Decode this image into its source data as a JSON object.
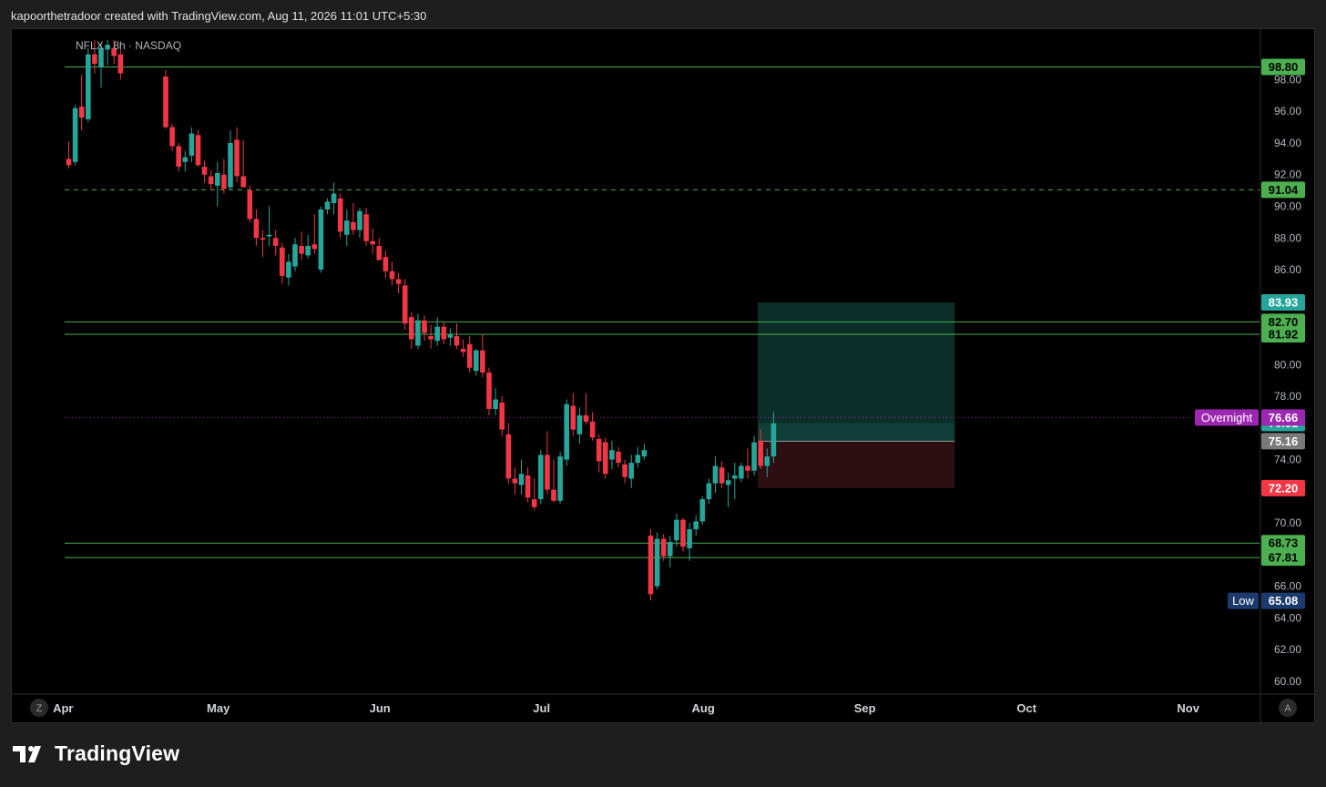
{
  "header": {
    "credit": "kapoorthetradoor created with TradingView.com, Aug 11, 2026 11:01 UTC+5:30"
  },
  "symbol_legend": "NFLX · 8h · NASDAQ",
  "footer": {
    "brand": "TradingView"
  },
  "corner_buttons": {
    "left": "Z",
    "right": "A"
  },
  "colors": {
    "up": "#26a69a",
    "down": "#f23645",
    "level": "#4caf50",
    "target_zone": "#0b2e28",
    "stop_zone": "#2d0e12",
    "overnight": "#9c27b0",
    "low_badge": "#1c3a6e",
    "current": "#7a7a7a"
  },
  "chart_data": {
    "type": "candlestick",
    "ylim": [
      58.5,
      100.5
    ],
    "y_ticks": [
      "60.00",
      "62.00",
      "64.00",
      "66.00",
      "70.00",
      "74.00",
      "78.00",
      "80.00",
      "86.00",
      "88.00",
      "90.00",
      "92.00",
      "94.00",
      "96.00",
      "98.00"
    ],
    "x_ticks": [
      {
        "label": "Apr",
        "bar": -2
      },
      {
        "label": "May",
        "bar": 22
      },
      {
        "label": "Jun",
        "bar": 47
      },
      {
        "label": "Jul",
        "bar": 72
      },
      {
        "label": "Aug",
        "bar": 97
      },
      {
        "label": "Sep",
        "bar": 122
      },
      {
        "label": "Oct",
        "bar": 147
      },
      {
        "label": "Nov",
        "bar": 172
      }
    ],
    "candles": [
      [
        0,
        93.0,
        94.1,
        92.4,
        92.6
      ],
      [
        1,
        92.8,
        96.4,
        92.6,
        96.2
      ],
      [
        2,
        96.3,
        98.3,
        94.8,
        95.6
      ],
      [
        3,
        95.5,
        100.0,
        95.3,
        99.6
      ],
      [
        4,
        99.6,
        100.5,
        98.4,
        99.0
      ],
      [
        5,
        98.8,
        100.3,
        97.5,
        100.0
      ],
      [
        6,
        99.9,
        100.5,
        98.9,
        100.2
      ],
      [
        7,
        100.0,
        100.5,
        99.0,
        99.5
      ],
      [
        8,
        99.6,
        100.3,
        98.0,
        98.4
      ],
      [
        15,
        98.2,
        98.6,
        94.9,
        95.0
      ],
      [
        16,
        95.0,
        95.2,
        93.5,
        93.8
      ],
      [
        17,
        93.8,
        94.0,
        92.2,
        92.5
      ],
      [
        18,
        92.8,
        93.5,
        92.2,
        93.1
      ],
      [
        19,
        93.2,
        95.0,
        92.8,
        94.6
      ],
      [
        20,
        94.5,
        94.8,
        92.5,
        92.6
      ],
      [
        21,
        92.5,
        92.9,
        91.5,
        92.0
      ],
      [
        22,
        91.9,
        92.3,
        91.0,
        91.4
      ],
      [
        23,
        91.3,
        92.8,
        90.0,
        92.1
      ],
      [
        24,
        92.0,
        93.0,
        90.8,
        91.1
      ],
      [
        25,
        91.2,
        94.8,
        91.0,
        94.0
      ],
      [
        26,
        94.2,
        95.0,
        91.5,
        91.9
      ],
      [
        27,
        91.9,
        94.2,
        91.4,
        91.2
      ],
      [
        28,
        91.0,
        91.3,
        89.0,
        89.2
      ],
      [
        29,
        89.2,
        89.8,
        87.5,
        88.0
      ],
      [
        30,
        88.0,
        88.5,
        86.8,
        87.9
      ],
      [
        31,
        88.1,
        90.0,
        87.5,
        88.2
      ],
      [
        32,
        88.0,
        88.5,
        86.9,
        87.5
      ],
      [
        33,
        87.4,
        87.7,
        85.1,
        85.6
      ],
      [
        34,
        85.5,
        87.0,
        85.0,
        86.5
      ],
      [
        35,
        86.2,
        88.0,
        85.9,
        87.6
      ],
      [
        36,
        87.5,
        88.4,
        86.6,
        87.0
      ],
      [
        37,
        86.9,
        88.2,
        86.7,
        87.5
      ],
      [
        38,
        87.6,
        89.5,
        87.0,
        87.3
      ],
      [
        39,
        86.0,
        90.0,
        85.8,
        89.8
      ],
      [
        40,
        89.8,
        90.5,
        89.5,
        90.3
      ],
      [
        41,
        90.2,
        91.5,
        89.5,
        90.8
      ],
      [
        42,
        90.5,
        90.8,
        88.0,
        88.4
      ],
      [
        43,
        88.2,
        89.8,
        87.5,
        89.1
      ],
      [
        44,
        89.0,
        90.2,
        88.2,
        88.5
      ],
      [
        45,
        88.5,
        89.9,
        88.0,
        89.7
      ],
      [
        46,
        89.5,
        89.9,
        87.5,
        87.8
      ],
      [
        47,
        87.8,
        88.6,
        87.0,
        87.6
      ],
      [
        48,
        87.5,
        88.0,
        86.6,
        86.6
      ],
      [
        49,
        86.8,
        87.2,
        85.5,
        85.9
      ],
      [
        50,
        85.9,
        86.5,
        85.0,
        85.4
      ],
      [
        51,
        85.4,
        85.8,
        84.5,
        85.1
      ],
      [
        52,
        85.0,
        85.4,
        82.2,
        82.6
      ],
      [
        53,
        83.0,
        83.3,
        81.0,
        81.6
      ],
      [
        54,
        81.2,
        83.2,
        81.0,
        82.8
      ],
      [
        55,
        82.8,
        83.1,
        81.5,
        82.0
      ],
      [
        56,
        81.8,
        82.5,
        81.0,
        81.6
      ],
      [
        57,
        81.5,
        83.0,
        81.2,
        82.4
      ],
      [
        58,
        82.4,
        82.7,
        81.3,
        81.6
      ],
      [
        59,
        81.7,
        82.3,
        81.2,
        81.9
      ],
      [
        60,
        81.8,
        82.6,
        81.0,
        81.2
      ],
      [
        61,
        81.0,
        81.6,
        80.5,
        80.8
      ],
      [
        62,
        81.3,
        81.8,
        79.5,
        79.8
      ],
      [
        63,
        79.6,
        81.0,
        79.3,
        80.9
      ],
      [
        64,
        80.9,
        81.9,
        79.2,
        79.5
      ],
      [
        65,
        79.5,
        79.8,
        76.8,
        77.2
      ],
      [
        66,
        77.2,
        78.5,
        76.8,
        77.8
      ],
      [
        67,
        77.6,
        78.0,
        75.5,
        75.9
      ],
      [
        68,
        75.6,
        76.3,
        72.5,
        72.8
      ],
      [
        69,
        72.8,
        73.5,
        71.8,
        72.5
      ],
      [
        70,
        72.4,
        74.0,
        71.8,
        73.1
      ],
      [
        71,
        73.0,
        73.5,
        71.3,
        71.6
      ],
      [
        72,
        71.5,
        72.8,
        70.8,
        71.0
      ],
      [
        73,
        71.5,
        74.6,
        71.2,
        74.3
      ],
      [
        74,
        74.3,
        75.8,
        71.8,
        72.1
      ],
      [
        75,
        72.1,
        74.0,
        71.3,
        71.4
      ],
      [
        76,
        71.4,
        74.5,
        71.2,
        74.2
      ],
      [
        77,
        74.0,
        77.8,
        73.6,
        77.5
      ],
      [
        78,
        77.4,
        78.2,
        75.5,
        75.9
      ],
      [
        79,
        75.6,
        77.3,
        75.0,
        76.8
      ],
      [
        80,
        76.8,
        78.2,
        76.2,
        76.4
      ],
      [
        81,
        76.4,
        77.0,
        75.2,
        75.4
      ],
      [
        82,
        75.3,
        75.6,
        73.2,
        73.9
      ],
      [
        83,
        75.1,
        75.4,
        72.8,
        73.1
      ],
      [
        84,
        74.0,
        75.2,
        73.4,
        74.6
      ],
      [
        85,
        74.5,
        74.8,
        73.5,
        73.8
      ],
      [
        86,
        73.7,
        74.0,
        72.5,
        72.9
      ],
      [
        87,
        72.8,
        74.3,
        72.2,
        73.8
      ],
      [
        88,
        73.8,
        74.8,
        73.5,
        74.3
      ],
      [
        89,
        74.2,
        75.0,
        74.0,
        74.6
      ],
      [
        90,
        69.2,
        69.6,
        65.1,
        65.5
      ],
      [
        91,
        66.0,
        69.4,
        65.8,
        69.0
      ],
      [
        92,
        69.0,
        69.3,
        67.6,
        67.9
      ],
      [
        93,
        67.9,
        69.2,
        67.2,
        68.8
      ],
      [
        94,
        68.9,
        70.6,
        68.5,
        70.2
      ],
      [
        95,
        70.2,
        70.3,
        68.2,
        68.5
      ],
      [
        96,
        68.4,
        70.0,
        67.6,
        69.6
      ],
      [
        97,
        69.6,
        70.5,
        69.2,
        70.1
      ],
      [
        98,
        70.1,
        71.7,
        69.9,
        71.5
      ],
      [
        99,
        71.5,
        72.8,
        71.2,
        72.5
      ],
      [
        100,
        72.5,
        74.2,
        71.9,
        73.6
      ],
      [
        101,
        73.5,
        73.9,
        72.2,
        72.5
      ],
      [
        102,
        72.4,
        73.2,
        71.0,
        72.7
      ],
      [
        103,
        72.8,
        73.8,
        71.5,
        73.0
      ],
      [
        104,
        72.8,
        73.8,
        72.6,
        73.6
      ],
      [
        105,
        73.6,
        74.7,
        72.8,
        73.3
      ],
      [
        106,
        73.3,
        75.5,
        73.0,
        75.1
      ],
      [
        107,
        75.2,
        75.9,
        73.4,
        73.6
      ],
      [
        108,
        73.6,
        74.7,
        72.9,
        74.2
      ],
      [
        109,
        74.2,
        77.0,
        73.8,
        76.3
      ]
    ],
    "horizontal_levels": [
      {
        "value": 98.8,
        "label": "98.80",
        "style": "solid"
      },
      {
        "value": 91.04,
        "label": "91.04",
        "style": "dashed"
      },
      {
        "value": 82.7,
        "label": "82.70",
        "style": "solid"
      },
      {
        "value": 81.92,
        "label": "81.92",
        "style": "solid"
      },
      {
        "value": 68.73,
        "label": "68.73",
        "style": "solid"
      },
      {
        "value": 67.81,
        "label": "67.81",
        "style": "solid"
      }
    ],
    "position_tool": {
      "entry": 75.16,
      "target": 83.93,
      "stop": 72.2,
      "from_bar": 107,
      "to_bar": 137,
      "labels": {
        "target": "83.93",
        "entry": "75.16",
        "stop": "72.20"
      }
    },
    "overnight": {
      "value": 76.66,
      "label": "Overnight",
      "price": "76.66"
    },
    "last_price": {
      "value": 76.31,
      "label": "76.31"
    },
    "low": {
      "value": 65.08,
      "label": "Low",
      "price": "65.08"
    }
  }
}
